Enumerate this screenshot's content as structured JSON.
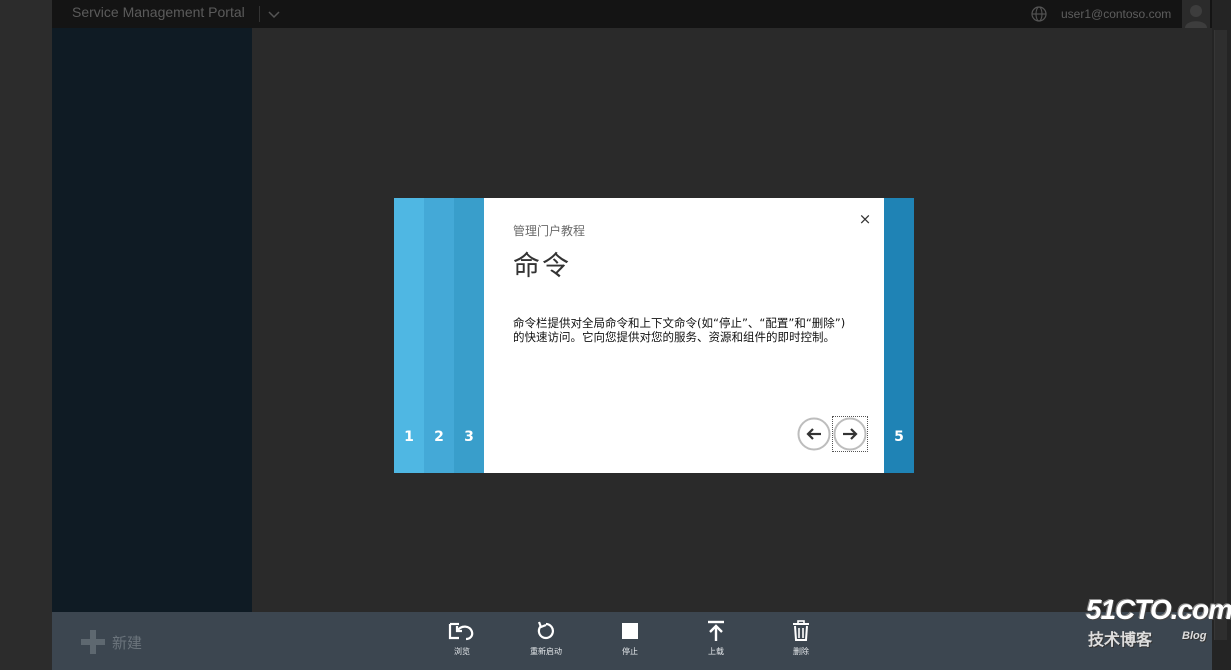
{
  "header": {
    "portal_title": "Service Management Portal",
    "user_email": "user1@contoso.com"
  },
  "dialog": {
    "kicker": "管理门户教程",
    "title": "命令",
    "body_line1": "命令栏提供对全局命令和上下文命令(如“停止”、“配置”和“删除”)",
    "body_line2": "的快速访问。它向您提供对您的服务、资源和组件的即时控制。",
    "close_symbol": "×",
    "steps": [
      "1",
      "2",
      "3",
      "5"
    ],
    "colors": {
      "step1": "#4fb7e3",
      "step2": "#44a9d7",
      "step3": "#399ecb",
      "step5": "#1f83b5"
    }
  },
  "command_bar": {
    "new_label": "新建",
    "commands": [
      {
        "label": "浏览",
        "icon": "browse-icon"
      },
      {
        "label": "重新启动",
        "icon": "restart-icon"
      },
      {
        "label": "停止",
        "icon": "stop-icon"
      },
      {
        "label": "上载",
        "icon": "upload-icon"
      },
      {
        "label": "删除",
        "icon": "delete-icon"
      }
    ]
  },
  "watermark": {
    "main": "51CTO.com",
    "sub": "技术博客",
    "blog": "Blog"
  }
}
